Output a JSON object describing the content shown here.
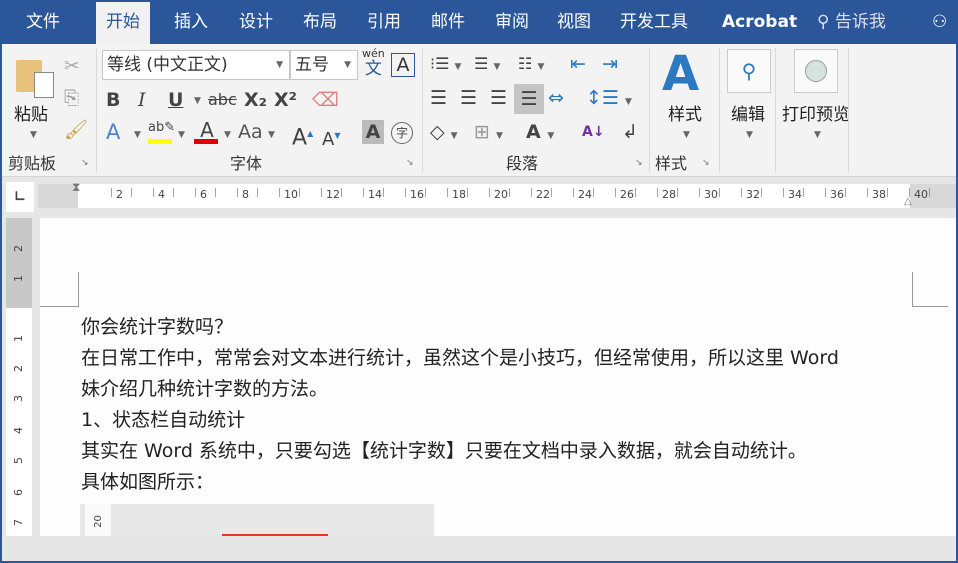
{
  "tabs": [
    "文件",
    "开始",
    "插入",
    "设计",
    "布局",
    "引用",
    "邮件",
    "审阅",
    "视图",
    "开发工具",
    "Acrobat"
  ],
  "tell_me": "告诉我",
  "clipboard": {
    "paste": "粘贴",
    "group": "剪贴板"
  },
  "font": {
    "name": "等线 (中文正文)",
    "size": "五号",
    "phonetic": "wén",
    "phonetic_char": "文",
    "bold": "B",
    "italic": "I",
    "underline": "U",
    "strike": "abc",
    "sub": "X₂",
    "sup": "X²",
    "case": "Aa",
    "grow": "A",
    "shrink": "A",
    "shade": "A",
    "enclose": "字",
    "group": "字体",
    "highlight_color": "#ffff00",
    "font_color": "#e00000"
  },
  "paragraph": {
    "group": "段落"
  },
  "styles": {
    "label": "样式",
    "group": "样式"
  },
  "editing": {
    "label": "编辑"
  },
  "print_preview": {
    "label": "打印预览"
  },
  "ruler": {
    "ticks": [
      "2",
      "4",
      "6",
      "8",
      "10",
      "12",
      "14",
      "16",
      "18",
      "20",
      "22",
      "24",
      "26",
      "28",
      "30",
      "32",
      "34",
      "36",
      "38",
      "40"
    ],
    "vticks": [
      "2",
      "1",
      "1",
      "2",
      "3",
      "4",
      "5",
      "6",
      "7"
    ]
  },
  "document": {
    "lines": [
      "你会统计字数吗？",
      "在日常工作中，常常会对文本进行统计，虽然这个是小技巧，但经常使用，所以这里 Word",
      "妹介绍几种统计字数的方法。",
      "1、状态栏自动统计",
      "其实在 Word 系统中，只要勾选【统计字数】只要在文档中录入数据，就会自动统计。",
      "具体如图所示："
    ],
    "embedded_ruler": "20"
  }
}
